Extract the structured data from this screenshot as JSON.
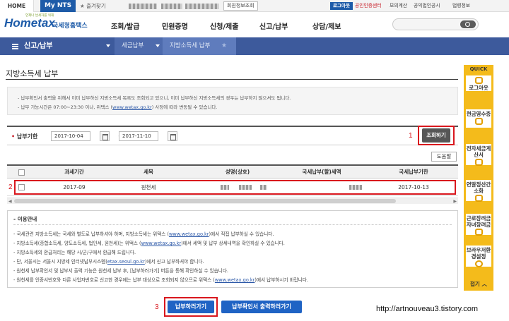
{
  "topbar": {
    "home": "HOME",
    "mynts": "My NTS",
    "favorites": "즐겨찾기",
    "my_info": "회원정보조회",
    "logout": "로그아웃",
    "links": [
      "공인인증센터",
      "모의계산",
      "공익법인공시",
      "법령정보"
    ]
  },
  "header": {
    "logo": "Hometax",
    "logo_tagline": "언제나 납세자를 위해",
    "service_name": "국세청홈택스",
    "gnb": [
      "조회/발급",
      "민원증명",
      "신청/제출",
      "신고/납부",
      "상담/제보"
    ],
    "search_placeholder": ""
  },
  "nav": {
    "title": "신고/납부",
    "crumbs": [
      "세금납부",
      "지방소득세 납부"
    ]
  },
  "quick": {
    "title": "QUICK",
    "items": [
      "로그아웃",
      "현금영수증",
      "전자세금계산서",
      "연말정산간소화",
      "근로장려금자녀장려금",
      "브라우저환경설정"
    ],
    "close": "접기"
  },
  "page": {
    "title": "지방소득세 납부"
  },
  "notice": {
    "line1": "- 납부확인서 출력을 위해서 이미 납부하신 지방소득세 목록도 조회되고 있으니, 이미 납부하신 지방소득세의 경우는 납부하지 않으셔도 됩니다.",
    "line2_pre": "- 납부 가능시간은 07:00~23:30 이나, 위택스 (",
    "line2_link": "www.wetax.go.kr",
    "line2_post": ") 사정에 따라 변동될 수 있습니다."
  },
  "filter": {
    "label": "납부기한",
    "start_date": "2017-10-04",
    "end_date": "2017-11-10",
    "search_button": "조회하기",
    "help_button": "도움말"
  },
  "table": {
    "headers": [
      "과세기간",
      "세목",
      "성명(상호)",
      "국세납부(할)세액",
      "국세납부기한"
    ],
    "rows": [
      {
        "period": "2017-09",
        "tax_item": "원천세",
        "due": "2017-10-13"
      }
    ]
  },
  "guide": {
    "title": "- 이용안내",
    "lines": [
      {
        "pre": "- 국세관련 지방소득세는 국세와 별도로 납부하셔야 하며, 지방소득세는 위택스 (",
        "link": "www.wetax.go.kr",
        "post": ")에서 직접 납부하실 수 있습니다."
      },
      {
        "pre": "- 지방소득세(종합소득세, 양도소득세, 법인세, 원천세)는 위택스 (",
        "link": "www.wetax.go.kr",
        "post": ")에서 세액 및 납부 상세내역을 확인하실 수 있습니다."
      },
      {
        "pre": "- 지방소득세의 환급처리는 해당 시/군/구에서 환급해 드립니다.",
        "link": "",
        "post": ""
      },
      {
        "pre": "- 단, 서울시는 서울시 지방세 인터넷납부시스템(",
        "link": "etax.seoul.go.kr",
        "post": ")에서 신고 납부하셔야 합니다."
      },
      {
        "pre": "- 원천세 납부확인서 및 납부서 출력 기능은 원천세 납부 후, [납부하러가기] 버튼을 통해 확인하실 수 있습니다.",
        "link": "",
        "post": ""
      },
      {
        "pre": "- 원천세를 인증서번호와 다른 사업자번호로 신고한 경우에는 납부 대상으로 조회되지 않으므로 위택스 (",
        "link": "www.wetax.go.kr",
        "post": ")에서 납부하시기 바랍니다."
      }
    ]
  },
  "actions": {
    "pay_button": "납부하러가기",
    "print_button": "납부확인서 출력하러가기"
  },
  "annotations": {
    "step1": "1",
    "step2": "2",
    "step3": "3"
  },
  "watermark": "http://artnouveau3.tistory.com",
  "colors": {
    "brand_blue": "#1d5ba8",
    "nav_blue": "#3d5a9c",
    "quick_yellow": "#f4bb1b",
    "annotation_red": "#d9171e",
    "button_blue": "#1f63c4"
  }
}
